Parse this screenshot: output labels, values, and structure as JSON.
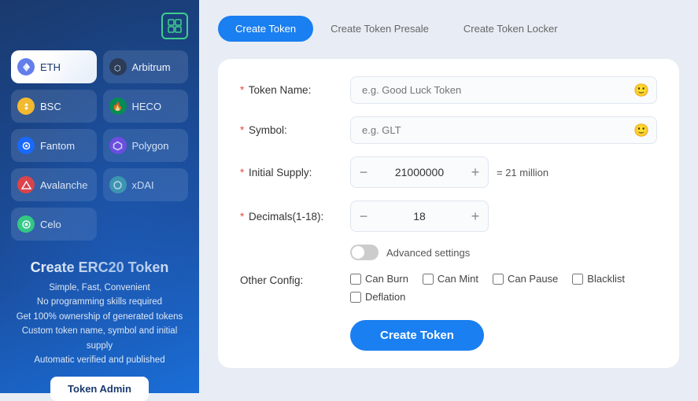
{
  "sidebar": {
    "logo_char": "{}",
    "networks": [
      {
        "id": "eth",
        "label": "ETH",
        "icon": "◆",
        "icon_class": "net-eth",
        "active": true
      },
      {
        "id": "arbitrum",
        "label": "Arbitrum",
        "icon": "⬡",
        "icon_class": "net-arbitrum",
        "active": false
      },
      {
        "id": "bsc",
        "label": "BSC",
        "icon": "◈",
        "icon_class": "net-bsc",
        "active": false
      },
      {
        "id": "heco",
        "label": "HECO",
        "icon": "🔥",
        "icon_class": "net-heco",
        "active": false
      },
      {
        "id": "fantom",
        "label": "Fantom",
        "icon": "◉",
        "icon_class": "net-fantom",
        "active": false
      },
      {
        "id": "polygon",
        "label": "Polygon",
        "icon": "⬡",
        "icon_class": "net-polygon",
        "active": false
      },
      {
        "id": "avalanche",
        "label": "Avalanche",
        "icon": "▲",
        "icon_class": "net-avalanche",
        "active": false
      },
      {
        "id": "xdai",
        "label": "xDAI",
        "icon": "◎",
        "icon_class": "net-xdai",
        "active": false
      },
      {
        "id": "celo",
        "label": "Celo",
        "icon": "◎",
        "icon_class": "net-celo",
        "active": false
      }
    ],
    "title": "Create ERC20 Token",
    "description_lines": [
      "Simple, Fast, Convenient",
      "No programming skills required",
      "Get 100% ownership of generated tokens",
      "Custom token name, symbol and initial supply",
      "Automatic verified and published"
    ],
    "token_admin_label": "Token Admin"
  },
  "tabs": [
    {
      "id": "create-token",
      "label": "Create Token",
      "active": true
    },
    {
      "id": "create-presale",
      "label": "Create Token Presale",
      "active": false
    },
    {
      "id": "create-locker",
      "label": "Create Token Locker",
      "active": false
    }
  ],
  "form": {
    "token_name": {
      "label": "Token Name:",
      "placeholder": "e.g. Good Luck Token",
      "value": ""
    },
    "symbol": {
      "label": "Symbol:",
      "placeholder": "e.g. GLT",
      "value": ""
    },
    "initial_supply": {
      "label": "Initial Supply:",
      "value": "21000000",
      "equal_text": "= 21 million"
    },
    "decimals": {
      "label": "Decimals(1-18):",
      "value": "18"
    },
    "advanced_settings": {
      "label": "Advanced settings",
      "enabled": false
    },
    "other_config": {
      "label": "Other Config:",
      "options": [
        {
          "id": "can-burn",
          "label": "Can Burn",
          "checked": false
        },
        {
          "id": "can-mint",
          "label": "Can Mint",
          "checked": false
        },
        {
          "id": "can-pause",
          "label": "Can Pause",
          "checked": false
        },
        {
          "id": "blacklist",
          "label": "Blacklist",
          "checked": false
        },
        {
          "id": "deflation",
          "label": "Deflation",
          "checked": false
        }
      ]
    },
    "submit_label": "Create Token"
  },
  "icons": {
    "minus": "−",
    "plus": "+",
    "emoji": "🙂",
    "logo": "{}"
  }
}
